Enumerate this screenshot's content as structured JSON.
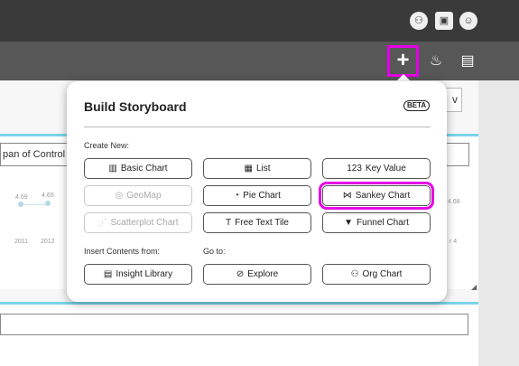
{
  "topbar": {
    "icons": [
      "user-group-icon",
      "badge-icon",
      "account-icon"
    ]
  },
  "toolbar": {
    "icons": [
      "plus-icon",
      "palette-icon",
      "save-icon"
    ]
  },
  "background": {
    "button_label": "v",
    "panel_title": "pan of Control",
    "chart_values": [
      "4.69",
      "4.69"
    ],
    "chart_years": [
      "2011",
      "2012"
    ],
    "right_value": "4.68",
    "right_tick": "r 4"
  },
  "popover": {
    "title": "Build Storyboard",
    "beta_badge": "BETA",
    "create_new_label": "Create New:",
    "insert_label": "Insert Contents from:",
    "goto_label": "Go to:",
    "create_options": [
      {
        "label": "Basic Chart",
        "icon": "bar-chart-icon",
        "glyph": "▥"
      },
      {
        "label": "List",
        "icon": "list-icon",
        "glyph": "▦"
      },
      {
        "label": "Key Value",
        "icon": "key-value-icon",
        "glyph": "123"
      },
      {
        "label": "GeoMap",
        "icon": "map-pin-icon",
        "glyph": "◎"
      },
      {
        "label": "Pie Chart",
        "icon": "pie-chart-icon",
        "glyph": "◔"
      },
      {
        "label": "Sankey Chart",
        "icon": "sankey-icon",
        "glyph": "⋈"
      },
      {
        "label": "Scatterplot Chart",
        "icon": "scatterplot-icon",
        "glyph": "⋰"
      },
      {
        "label": "Free Text Tile",
        "icon": "text-icon",
        "glyph": "T"
      },
      {
        "label": "Funnel Chart",
        "icon": "funnel-icon",
        "glyph": "▼"
      }
    ],
    "insert_options": [
      {
        "label": "Insight Library",
        "icon": "library-icon",
        "glyph": "▤"
      }
    ],
    "goto_options": [
      {
        "label": "Explore",
        "icon": "compass-icon",
        "glyph": "⊘"
      },
      {
        "label": "Org Chart",
        "icon": "org-chart-icon",
        "glyph": "⚇"
      }
    ]
  }
}
